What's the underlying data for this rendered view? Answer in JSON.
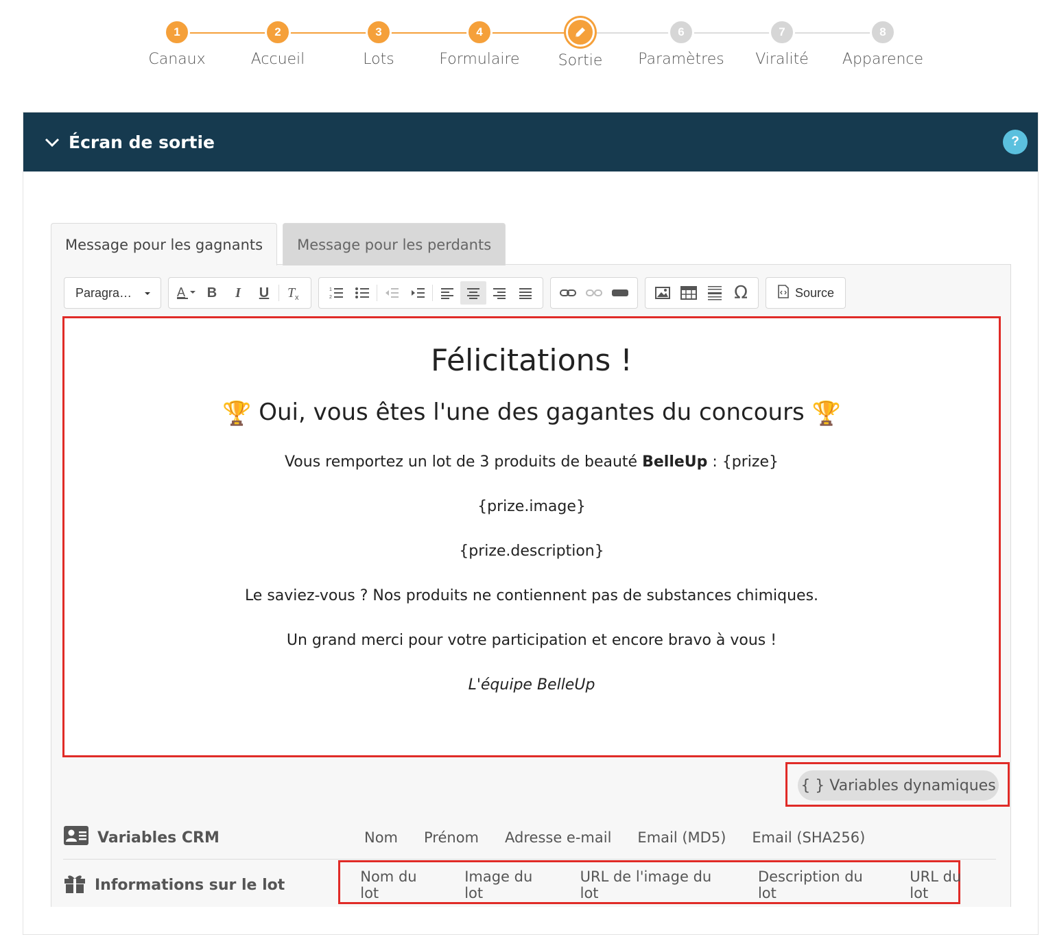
{
  "stepper": {
    "steps": [
      {
        "num": "1",
        "label": "Canaux",
        "state": "done"
      },
      {
        "num": "2",
        "label": "Accueil",
        "state": "done"
      },
      {
        "num": "3",
        "label": "Lots",
        "state": "done"
      },
      {
        "num": "4",
        "label": "Formulaire",
        "state": "done"
      },
      {
        "num": "",
        "label": "Sortie",
        "state": "current",
        "icon": "pencil-icon"
      },
      {
        "num": "6",
        "label": "Paramètres",
        "state": "todo"
      },
      {
        "num": "7",
        "label": "Viralité",
        "state": "todo"
      },
      {
        "num": "8",
        "label": "Apparence",
        "state": "todo"
      }
    ],
    "accent": "#f5a03a",
    "inactive": "#d6d6d6"
  },
  "section": {
    "title": "Écran de sortie",
    "help": "?",
    "header_color": "#163a4f"
  },
  "tabs": [
    {
      "label": "Message pour les gagnants",
      "active": true
    },
    {
      "label": "Message pour les perdants",
      "active": false
    }
  ],
  "toolbar": {
    "format_select": "Paragra…",
    "source_label": "Source"
  },
  "editor": {
    "heading": "Félicitations !",
    "subheading": "Oui, vous êtes l'une des gagantes du concours",
    "trophy": "🏆",
    "line1_pre": "Vous remportez un lot de 3 produits de beauté ",
    "line1_brand": "BelleUp",
    "line1_post": " : {prize}",
    "line2": "{prize.image}",
    "line3": "{prize.description}",
    "line4": "Le saviez-vous ? Nos produits ne contiennent pas de substances chimiques.",
    "line5": "Un grand merci pour votre participation et encore bravo à vous !",
    "signature": "L'équipe BelleUp"
  },
  "variables_button": "{ } Variables dynamiques",
  "crm": {
    "title": "Variables CRM",
    "items": [
      "Nom",
      "Prénom",
      "Adresse e-mail",
      "Email (MD5)",
      "Email (SHA256)"
    ]
  },
  "lot": {
    "title": "Informations sur le lot",
    "items": [
      "Nom du lot",
      "Image du lot",
      "URL de l'image du lot",
      "Description du lot",
      "URL du lot"
    ]
  },
  "highlight_color": "#e02b27"
}
